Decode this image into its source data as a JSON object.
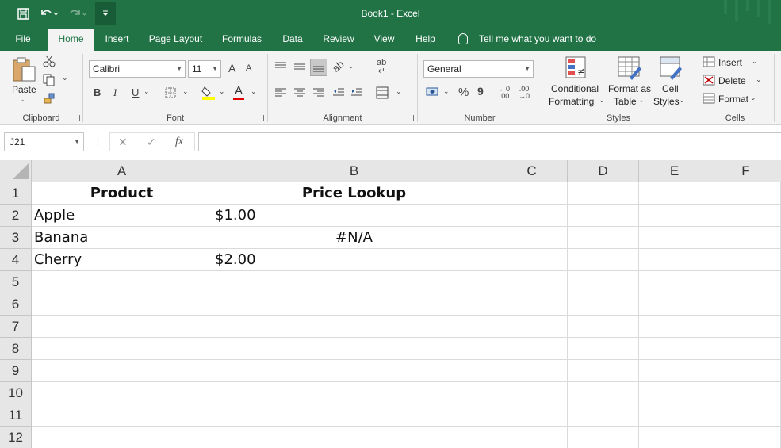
{
  "window": {
    "title": "Book1  -  Excel",
    "accent_color": "#217346"
  },
  "quick_access": {
    "icons": [
      "save-icon",
      "undo-icon",
      "redo-icon",
      "customize-icon"
    ]
  },
  "tabs": [
    {
      "label": "File"
    },
    {
      "label": "Home",
      "active": true
    },
    {
      "label": "Insert"
    },
    {
      "label": "Page Layout"
    },
    {
      "label": "Formulas"
    },
    {
      "label": "Data"
    },
    {
      "label": "Review"
    },
    {
      "label": "View"
    },
    {
      "label": "Help"
    }
  ],
  "tell_me": "Tell me what you want to do",
  "ribbon": {
    "clipboard": {
      "label": "Clipboard",
      "paste": "Paste"
    },
    "font": {
      "label": "Font",
      "font_name": "Calibri",
      "font_size": "11",
      "bold": "B",
      "italic": "I",
      "underline": "U",
      "grow": "A",
      "shrink": "A",
      "font_color": "A"
    },
    "alignment": {
      "label": "Alignment"
    },
    "number": {
      "label": "Number",
      "format": "General",
      "percent": "%",
      "comma": "9"
    },
    "styles": {
      "label": "Styles",
      "conditional": "Conditional",
      "conditional2": "Formatting",
      "format_as": "Format as",
      "format_as2": "Table",
      "cell": "Cell",
      "cell2": "Styles"
    },
    "cells": {
      "label": "Cells",
      "insert": "Insert",
      "delete": "Delete",
      "format": "Format"
    }
  },
  "formula_bar": {
    "name_box": "J21",
    "cancel": "✕",
    "enter": "✓",
    "fx": "fx",
    "value": ""
  },
  "sheet": {
    "columns": [
      "A",
      "B",
      "C",
      "D",
      "E",
      "F"
    ],
    "rows": [
      "1",
      "2",
      "3",
      "4",
      "5",
      "6",
      "7",
      "8",
      "9",
      "10",
      "11",
      "12"
    ],
    "cells": {
      "A1": "Product",
      "B1": "Price Lookup",
      "A2": "Apple",
      "B2": "$1.00",
      "A3": "Banana",
      "B3": "#N/A",
      "A4": "Cherry",
      "B4": "$2.00"
    }
  }
}
